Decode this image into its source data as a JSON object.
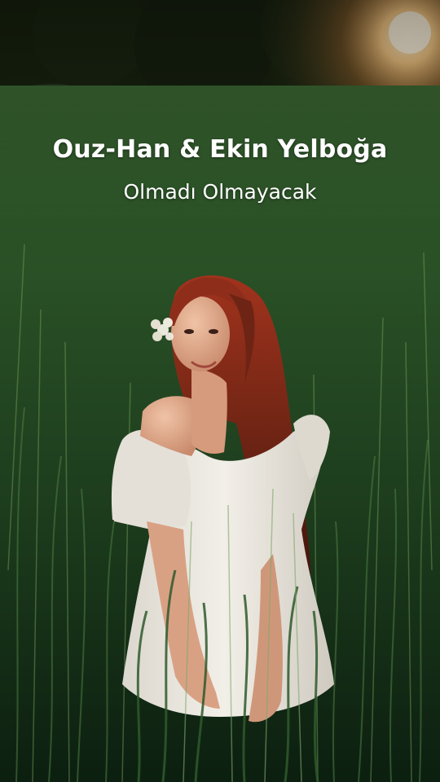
{
  "story": {
    "artist": "Ouz-Han & Ekin Yelboğa",
    "track_title": "Olmadı Olmayacak"
  },
  "background": {
    "description_icon": "photo-background",
    "colors": {
      "grass_dark": "#0f2412",
      "grass_mid": "#2f5a2c",
      "grass_light": "#5a8a4a",
      "sun": "#ffd9a0",
      "hair": "#7a2a18",
      "dress": "#e9e6df",
      "skin": "#e2ab8e"
    }
  }
}
